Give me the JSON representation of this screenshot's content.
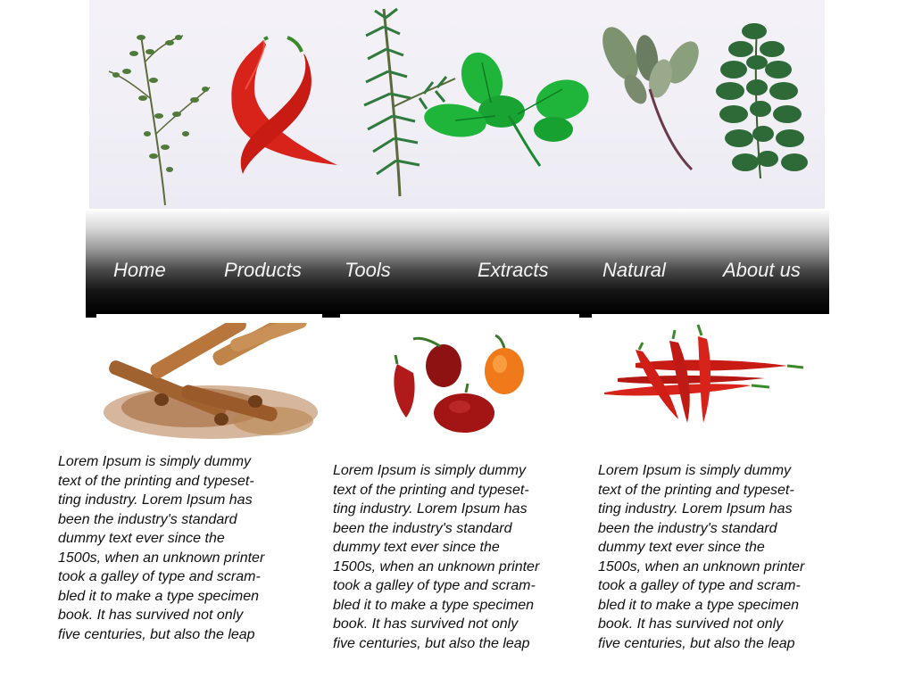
{
  "banner": {
    "herbs": [
      "thyme",
      "red-chili-pair",
      "rosemary",
      "basil",
      "sage",
      "oregano"
    ]
  },
  "nav": {
    "items": [
      {
        "label": "Home"
      },
      {
        "label": "Products"
      },
      {
        "label": "Tools"
      },
      {
        "label": "Extracts"
      },
      {
        "label": "Natural"
      },
      {
        "label": "About us"
      }
    ]
  },
  "products": [
    {
      "image": "cinnamon-sticks",
      "lines": [
        "Lorem Ipsum is simply dummy",
        "text of the printing and typeset-",
        "ting industry. Lorem Ipsum has",
        "been the industry's standard",
        "dummy text ever since the",
        "1500s, when an unknown printer",
        "took a galley of type and scram-",
        "bled it to make a type specimen",
        "book. It has survived not only",
        "five centuries, but also the leap"
      ]
    },
    {
      "image": "habanero-peppers",
      "lines": [
        "Lorem Ipsum is simply dummy",
        "text of the printing and typeset-",
        "ting industry. Lorem Ipsum has",
        "been the industry's standard",
        "dummy text ever since the",
        "1500s, when an unknown printer",
        "took a galley of type and scram-",
        "bled it to make a type specimen",
        "book. It has survived not only",
        "five centuries, but also the leap"
      ]
    },
    {
      "image": "red-chili-peppers",
      "lines": [
        "Lorem Ipsum is simply dummy",
        "text of the printing and typeset-",
        "ting industry. Lorem Ipsum has",
        "been the industry's standard",
        "dummy text ever since the",
        "1500s, when an unknown printer",
        "took a galley of type and scram-",
        "bled it to make a type specimen",
        "book. It has survived not only",
        "five centuries, but also the leap"
      ]
    }
  ],
  "colors": {
    "nav_text": "#f4f4f4",
    "chili_red": "#d8231a",
    "herb_green": "#2f7a3c",
    "basil_green": "#1fb53a",
    "cinnamon": "#9a5a2a"
  }
}
